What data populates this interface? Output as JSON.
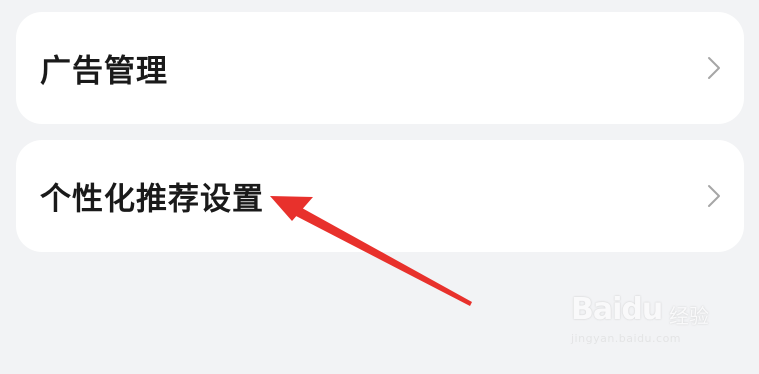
{
  "settings_items": [
    {
      "label": "广告管理",
      "chevron_icon": "chevron-right-icon"
    },
    {
      "label": "个性化推荐设置",
      "chevron_icon": "chevron-right-icon"
    }
  ],
  "annotation": {
    "type": "arrow",
    "color": "#e8312c",
    "points_to": "个性化推荐设置"
  },
  "watermark": {
    "brand": "Baidu",
    "brand_cn": "经验",
    "url": "jingyan.baidu.com"
  },
  "colors": {
    "background": "#f2f3f5",
    "card": "#ffffff",
    "text": "#1a1a1a",
    "chevron": "#a6a6a6"
  }
}
